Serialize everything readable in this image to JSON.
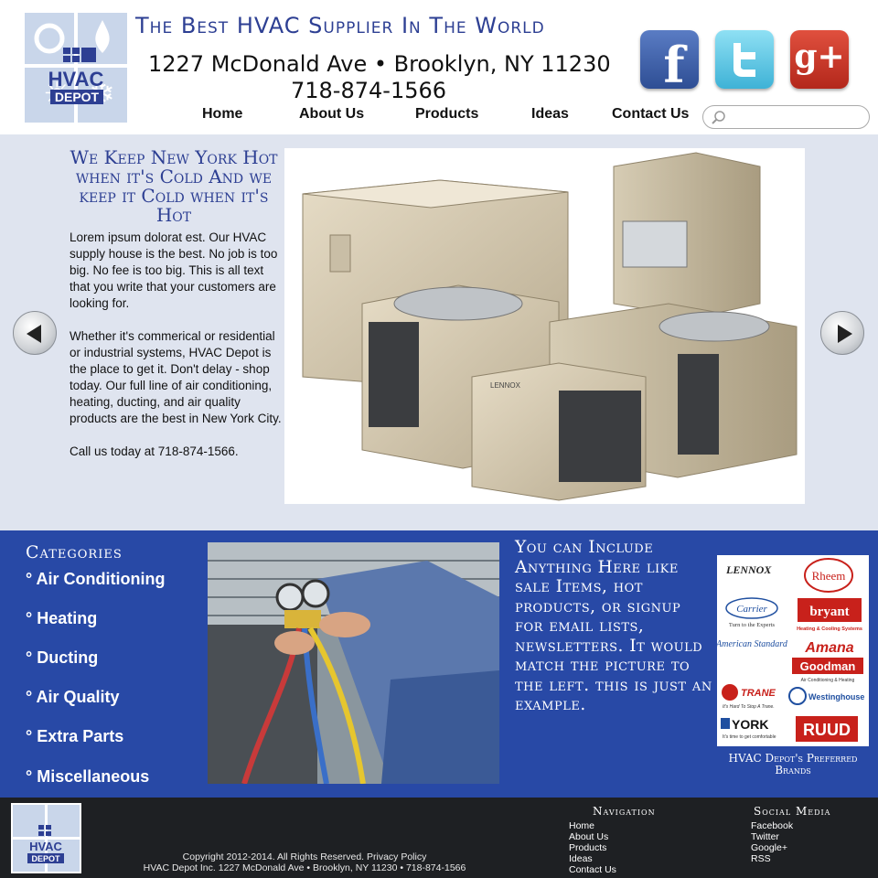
{
  "header": {
    "tagline": "The Best HVAC Supplier In The World",
    "address": "1227 McDonald Ave • Brooklyn, NY 11230",
    "phone": "718-874-1566",
    "logo_text_1": "HVAC",
    "logo_text_2": "DEPOT",
    "nav": [
      "Home",
      "About Us",
      "Products",
      "Ideas",
      "Contact Us"
    ],
    "search_placeholder": "",
    "social_glyphs": {
      "facebook": "f",
      "google_plus": "g+"
    }
  },
  "hero": {
    "title": "We Keep New York Hot when it's Cold And we keep it Cold when it's Hot",
    "body": "Lorem ipsum dolorat est.  Our HVAC supply house is the best.  No job is too big.  No fee is too big.  This is all text that you write that your customers are looking for.\n\nWhether it's commerical or residential or industrial systems, HVAC Depot is the place to get it.  Don't delay - shop today.  Our full line of air conditioning, heating, ducting, and air quality products are the best in New York City.\n\nCall us today at 718-874-1566.",
    "unit_label": "LENNOX"
  },
  "categories": {
    "title": "Categories",
    "items": [
      "° Air Conditioning",
      "° Heating",
      "° Ducting",
      "° Air Quality",
      "° Extra Parts",
      "° Miscellaneous"
    ]
  },
  "promo": {
    "text": "You can Include Anything Here like sale Items, hot products, or signup for email lists, newsletters.  It would match the picture to the left.  this is just an example."
  },
  "brands": {
    "logos": [
      "LENNOX",
      "Rheem",
      "Carrier",
      "bryant",
      "American Standard",
      "Amana",
      "Goodman",
      "TRANE",
      "Westinghouse",
      "YORK",
      "RUUD"
    ],
    "carrier_sub": "Turn to the Experts",
    "bryant_sub": "Heating & Cooling Systems",
    "goodman_sub": "Air Conditioning & Heating",
    "trane_sub": "It's Hard To Stop A Trane.",
    "york_sub": "It's time to get comfortable",
    "caption": "HVAC Depot's Preferred Brands"
  },
  "footer": {
    "copyright_line1": "Copyright 2012-2014.  All Rights Reserved.  Privacy Policy",
    "copyright_line2": "HVAC Depot Inc. 1227 McDonald Ave • Brooklyn, NY 11230 • 718-874-1566",
    "nav_title": "Navigation",
    "nav_links": [
      "Home",
      "About Us",
      "Products",
      "Ideas",
      "Contact Us"
    ],
    "social_title": "Social Media",
    "social_links": [
      "Facebook",
      "Twitter",
      "Google+",
      "RSS"
    ]
  },
  "colors": {
    "brand_blue": "#2d3f93",
    "band_blue": "#2849a6",
    "hero_bg": "#dfe4ef",
    "footer_bg": "#1e2023"
  }
}
